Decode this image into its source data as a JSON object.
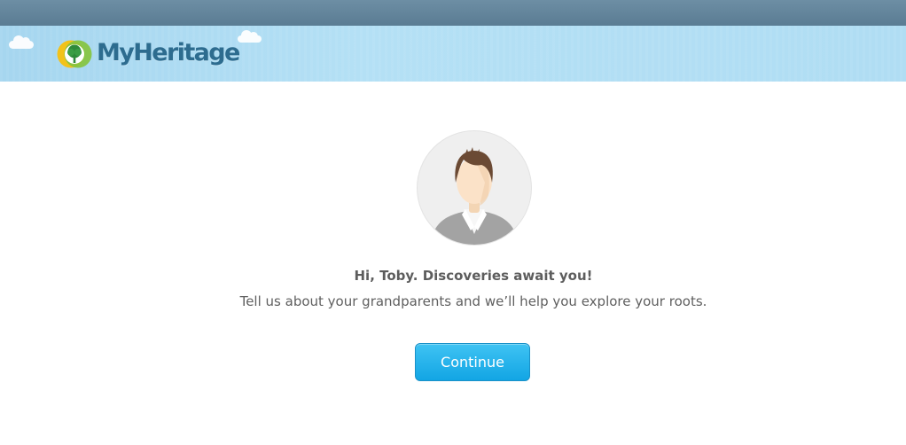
{
  "header": {
    "logo_text": "MyHeritage",
    "colors": {
      "top_strip": "#5f8197",
      "header_band": "#b0ddf3",
      "logo_text": "#2d6c8f"
    }
  },
  "main": {
    "avatar_icon": "default-male-avatar-icon",
    "greeting": "Hi, Toby. Discoveries await you!",
    "subtext": "Tell us about your grandparents and we’ll help you explore your roots.",
    "continue_label": "Continue",
    "colors": {
      "button": "#1aa9e8",
      "text": "#5d5d5d"
    }
  }
}
